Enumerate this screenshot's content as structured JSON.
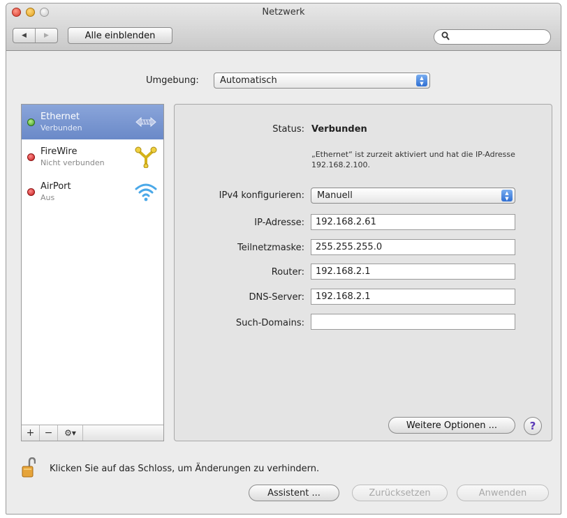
{
  "window": {
    "title": "Netzwerk"
  },
  "toolbar": {
    "back_glyph": "◀",
    "forward_glyph": "▶",
    "show_all_label": "Alle einblenden",
    "search_placeholder": ""
  },
  "environment": {
    "label": "Umgebung:",
    "value": "Automatisch"
  },
  "services": [
    {
      "name": "Ethernet",
      "status": "Verbunden",
      "state": "connected",
      "icon": "ethernet-icon",
      "selected": true
    },
    {
      "name": "FireWire",
      "status": "Nicht verbunden",
      "state": "disconnected",
      "icon": "firewire-icon",
      "selected": false
    },
    {
      "name": "AirPort",
      "status": "Aus",
      "state": "off",
      "icon": "airport-icon",
      "selected": false
    }
  ],
  "services_toolbar": {
    "add": "+",
    "remove": "−",
    "gear": "⚙▾"
  },
  "detail": {
    "status_label": "Status:",
    "status_value": "Verbunden",
    "status_description": "„Ethernet“ ist zurzeit aktiviert und hat die IP-Adresse 192.168.2.100.",
    "ipv4_label": "IPv4 konfigurieren:",
    "ipv4_value": "Manuell",
    "ip_label": "IP-Adresse:",
    "ip_value": "192.168.2.61",
    "subnet_label": "Teilnetzmaske:",
    "subnet_value": "255.255.255.0",
    "router_label": "Router:",
    "router_value": "192.168.2.1",
    "dns_label": "DNS-Server:",
    "dns_value": "192.168.2.1",
    "search_domains_label": "Such-Domains:",
    "search_domains_value": "",
    "more_options_label": "Weitere Optionen ...",
    "help_label": "?"
  },
  "footer": {
    "lock_text": "Klicken Sie auf das Schloss, um Änderungen zu verhindern.",
    "assistant_label": "Assistent ...",
    "revert_label": "Zurücksetzen",
    "apply_label": "Anwenden"
  },
  "colors": {
    "selection": "#7592cf",
    "connected": "#3f9a25",
    "disconnected": "#c21a1a",
    "help_accent": "#5b3ab8"
  }
}
